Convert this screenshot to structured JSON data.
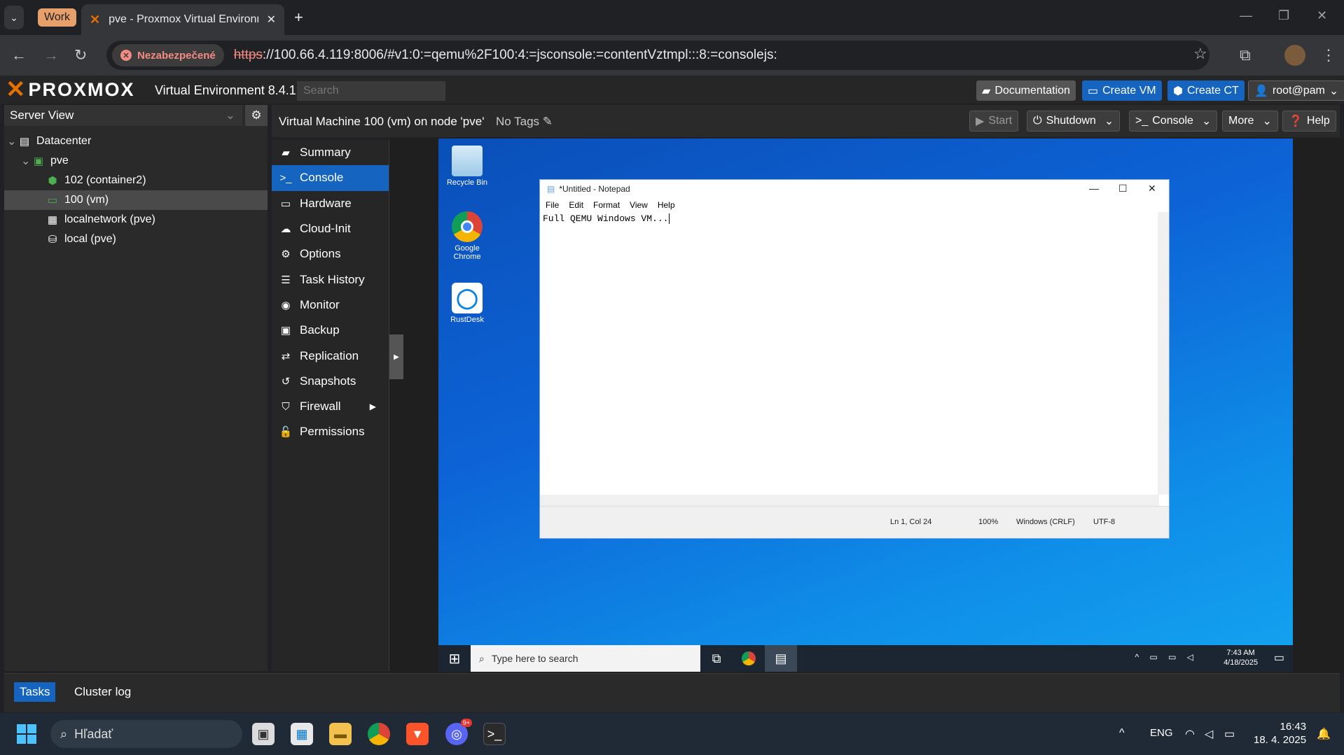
{
  "browser": {
    "tab_group": "Work",
    "tab_title": "pve - Proxmox Virtual Environm",
    "not_secure": "Nezabezpečené",
    "url_scheme": "https",
    "url_rest": "://100.66.4.119:8006/#v1:0:=qemu%2F100:4:=jsconsole:=contentVztmpl:::8:=consolejs:"
  },
  "header": {
    "logo": "PROXMOX",
    "version": "Virtual Environment 8.4.1",
    "search_placeholder": "Search",
    "documentation": "Documentation",
    "create_vm": "Create VM",
    "create_ct": "Create CT",
    "user": "root@pam"
  },
  "tree": {
    "view": "Server View",
    "nodes": [
      {
        "label": "Datacenter"
      },
      {
        "label": "pve"
      },
      {
        "label": "102 (container2)"
      },
      {
        "label": "100 (vm)"
      },
      {
        "label": "localnetwork (pve)"
      },
      {
        "label": "local (pve)"
      }
    ]
  },
  "content": {
    "title": "Virtual Machine 100 (vm) on node 'pve'",
    "tags": "No Tags",
    "start": "Start",
    "shutdown": "Shutdown",
    "console": "Console",
    "more": "More",
    "help": "Help"
  },
  "submenu": [
    {
      "label": "Summary",
      "icon": "book-icon"
    },
    {
      "label": "Console",
      "icon": "terminal-icon"
    },
    {
      "label": "Hardware",
      "icon": "monitor-icon"
    },
    {
      "label": "Cloud-Init",
      "icon": "cloud-icon"
    },
    {
      "label": "Options",
      "icon": "gear-icon"
    },
    {
      "label": "Task History",
      "icon": "list-icon"
    },
    {
      "label": "Monitor",
      "icon": "eye-icon"
    },
    {
      "label": "Backup",
      "icon": "floppy-icon"
    },
    {
      "label": "Replication",
      "icon": "retweet-icon"
    },
    {
      "label": "Snapshots",
      "icon": "history-icon"
    },
    {
      "label": "Firewall",
      "icon": "shield-icon"
    },
    {
      "label": "Permissions",
      "icon": "unlock-icon"
    }
  ],
  "vm": {
    "desktop_icons": [
      "Recycle Bin",
      "Google Chrome",
      "RustDesk"
    ],
    "notepad": {
      "title": "*Untitled - Notepad",
      "menu": [
        "File",
        "Edit",
        "Format",
        "View",
        "Help"
      ],
      "text": "Full QEMU Windows VM...",
      "status_pos": "Ln 1, Col 24",
      "status_zoom": "100%",
      "status_eol": "Windows (CRLF)",
      "status_enc": "UTF-8"
    },
    "taskbar_search": "Type here to search",
    "time": "7:43 AM",
    "date": "4/18/2025"
  },
  "bottom": {
    "tasks": "Tasks",
    "cluster_log": "Cluster log"
  },
  "host_taskbar": {
    "search": "Hľadať",
    "lang": "ENG",
    "time": "16:43",
    "date": "18. 4. 2025",
    "discord_badge": "9+"
  }
}
